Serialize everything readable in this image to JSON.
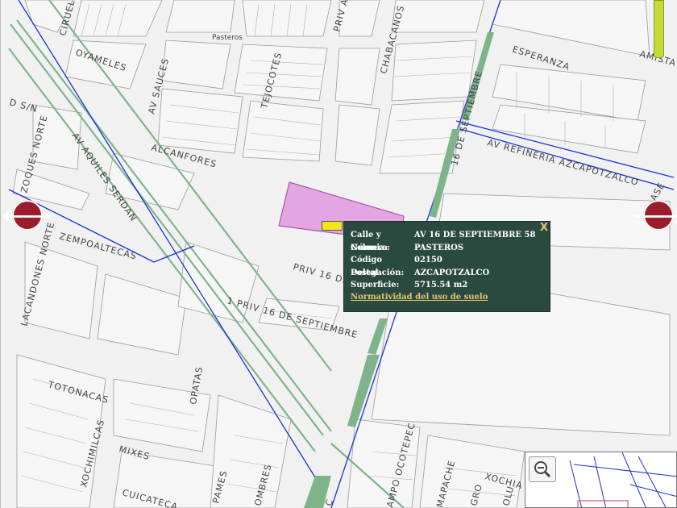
{
  "map": {
    "streets": {
      "ciruelos": "CIRUELOS",
      "oyameles": "OYAMELES",
      "av_sauces": "AV SAUCES",
      "tejocotes": "TEJOCOTES",
      "priv": "PRIV A",
      "chabacanos": "CHABACANOS",
      "esperanza": "ESPERANZA",
      "amistad": "AMISTA",
      "d_sn": "D S/N",
      "zoques_norte": "ZOQUES NORTE",
      "av_aquiles_serdan": "AV AQUILES SERDAN",
      "alcanfores": "ALCANFORES",
      "dieciseis_sep_vertical": "16 DE SEPTIEMBRE",
      "av_refineria": "AV REFINERIA AZCAPOTZALCO",
      "zempoaltecas": "ZEMPOALTECAS",
      "lacandones_norte": "LACANDONES NORTE",
      "priv_16_de": "PRIV 16 DE",
      "priv_16_sep": "1 PRIV 16 DE SEPTIEMBRE",
      "opatas": "OPATAS",
      "totonacas": "TOTONACAS",
      "xochimilcas": "XOCHIMILCAS",
      "mixes": "MIXES",
      "cuicatecas": "CUICATECA",
      "pames": "PAMES",
      "ocotepec": "AMPO OCOTEPEC",
      "mapache": "MAPACHE",
      "gro": "GRO",
      "xochi": "XOCHIA",
      "pasteros_small": "Pasteros",
      "colu": "OLU",
      "ombres": "OMBRES",
      "c_small": "C",
      "dase": "ASE"
    }
  },
  "popup": {
    "rows": [
      {
        "key": "Calle y Número:",
        "value": "AV 16 DE SEPTIEMBRE 58"
      },
      {
        "key": "Colonia:",
        "value": "PASTEROS"
      },
      {
        "key": "Código Postal:",
        "value": "02150"
      },
      {
        "key": "Delegación:",
        "value": "AZCAPOTZALCO"
      },
      {
        "key": "Superficie:",
        "value": "5715.54 m2"
      }
    ],
    "link": "Normatividad del uso de suelo",
    "close": "X"
  },
  "nav": {
    "prev": "🡐",
    "next": "🡒"
  },
  "colors": {
    "parcel": "#e3a6e3",
    "popup_bg": "#2b4a3f",
    "popup_link": "#e2c66e",
    "road_green": "#7fb48b",
    "road_blue": "#1a32d6",
    "nav_arrow": "#9b1c2a",
    "marker": "#f1e61d"
  },
  "icons": {
    "zoom_out": "zoom-out-icon",
    "prev": "arrow-left-icon",
    "next": "arrow-right-icon"
  }
}
